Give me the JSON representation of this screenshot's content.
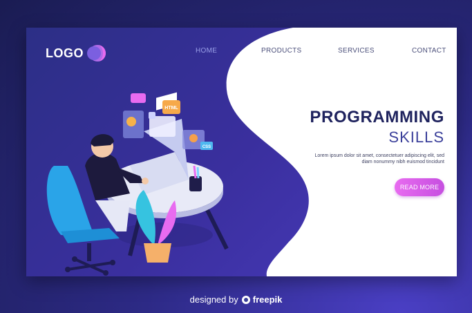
{
  "logo": {
    "text": "LOGO"
  },
  "nav": {
    "home": "HOME",
    "products": "PRODUCTS",
    "services": "SERVICES",
    "contact": "CONTACT"
  },
  "hero": {
    "title": "PROGRAMMING",
    "subtitle": "SKILLS",
    "description": "Lorem ipsum dolor sit amet, consectetuer adipiscing elit, sed diam nonummy nibh euismod tincidunt",
    "cta_label": "READ MORE"
  },
  "illustration": {
    "floating_labels": [
      "HTML",
      "CSS"
    ]
  },
  "credit": {
    "prefix": "designed by",
    "brand": "freepik"
  },
  "colors": {
    "card_bg": "#3a2f9e",
    "panel_bg": "#ffffff",
    "title": "#1f235e",
    "accent_pink": "#e86bf0",
    "chair_blue": "#2aa4e8"
  }
}
